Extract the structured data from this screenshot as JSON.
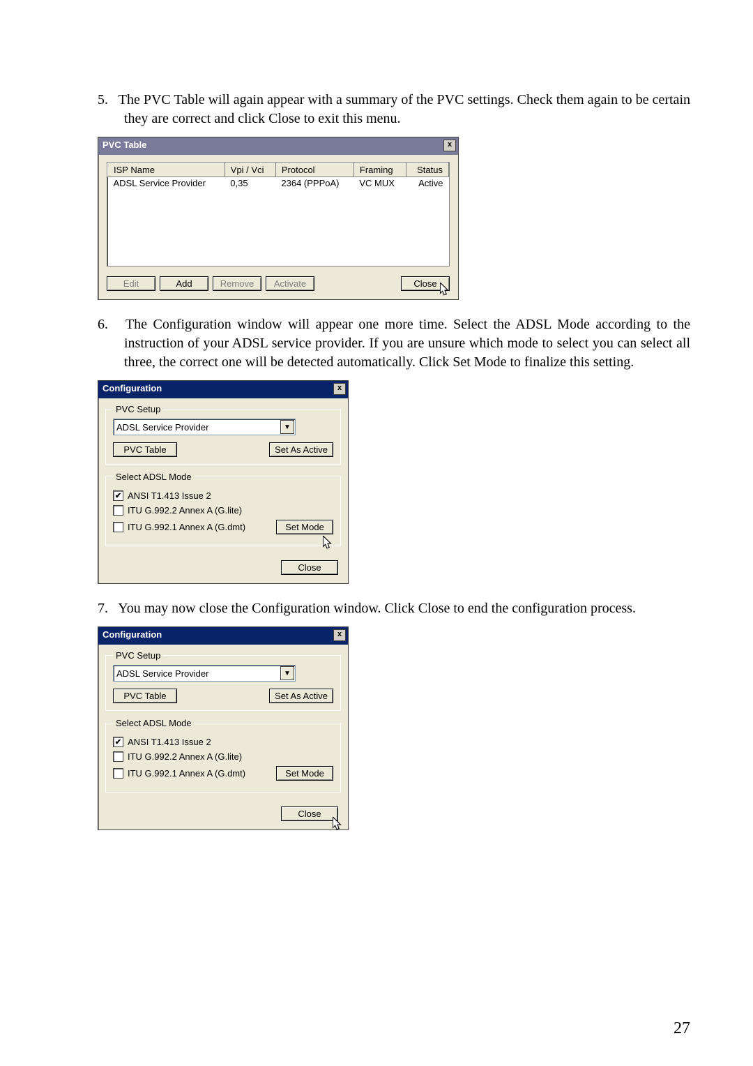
{
  "step5": {
    "num": "5.",
    "text": "The PVC Table will again appear with a summary of the PVC settings. Check them again to be certain they are correct and click Close to exit this menu."
  },
  "pvcTable": {
    "title": "PVC Table",
    "closeX": "x",
    "headers": {
      "isp": "ISP Name",
      "vpi": "Vpi / Vci",
      "proto": "Protocol",
      "framing": "Framing",
      "status": "Status"
    },
    "row": {
      "isp": "ADSL Service Provider",
      "vpi": "0,35",
      "proto": "2364 (PPPoA)",
      "framing": "VC MUX",
      "status": "Active"
    },
    "buttons": {
      "edit": "Edit",
      "add": "Add",
      "remove": "Remove",
      "activate": "Activate",
      "close": "Close"
    }
  },
  "step6": {
    "num": "6.",
    "text": "The Configuration window will appear one more time. Select the ADSL Mode according to the instruction of your ADSL service provider. If you are unsure which mode to select you can select all three, the correct one will be detected automatically. Click Set Mode to finalize this setting."
  },
  "config": {
    "title": "Configuration",
    "closeX": "x",
    "pvcSetupLegend": "PVC Setup",
    "combo": "ADSL Service Provider",
    "pvcTableBtn": "PVC Table",
    "setActiveBtn": "Set As Active",
    "modeLegend": "Select ADSL Mode",
    "chk1": {
      "checked": "✔",
      "label": "ANSI T1.413 Issue 2"
    },
    "chk2": {
      "checked": "",
      "label": "ITU G.992.2 Annex A (G.lite)"
    },
    "chk3": {
      "checked": "",
      "label": "ITU G.992.1 Annex A (G.dmt)"
    },
    "setModeBtn": "Set Mode",
    "closeBtn": "Close"
  },
  "step7": {
    "num": "7.",
    "text": "You may now close the Configuration window. Click Close to end the configuration process."
  },
  "pageNumber": "27"
}
